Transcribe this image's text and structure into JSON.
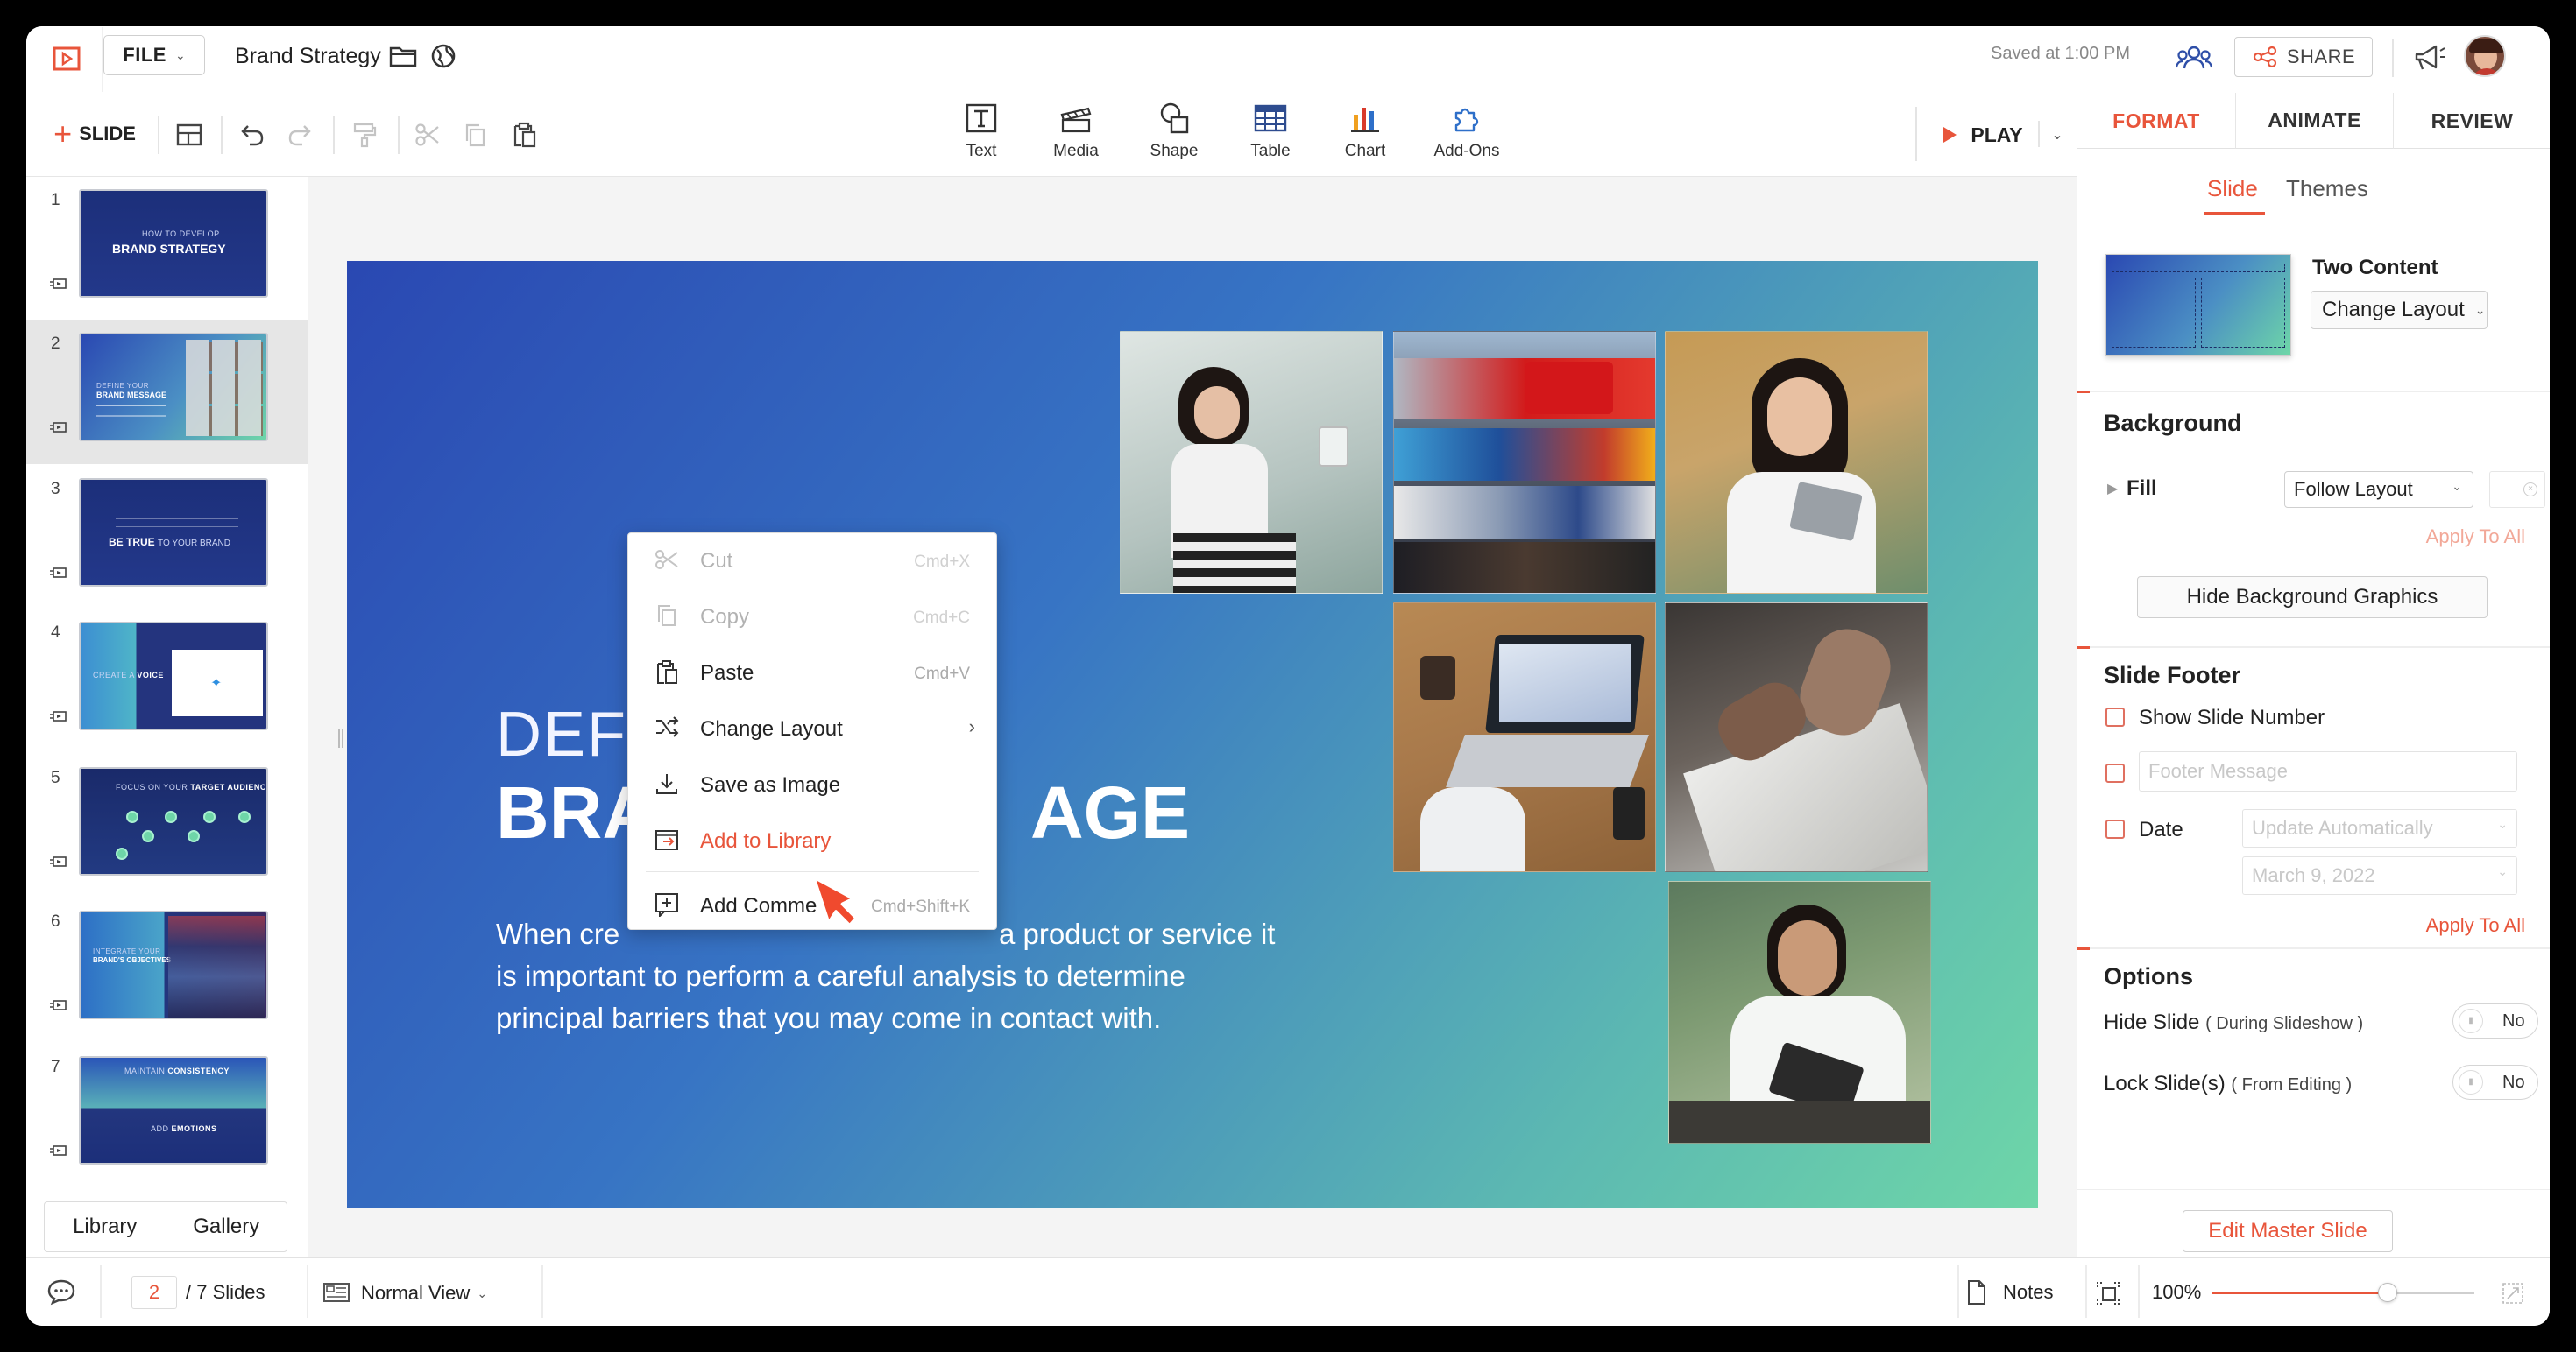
{
  "app": {
    "file_menu": "FILE",
    "doc_title": "Brand Strategy",
    "saved_status": "Saved at 1:00 PM",
    "share": "SHARE",
    "colors": {
      "accent": "#e8553b",
      "slide_from": "#2a48b2",
      "slide_to": "#6ed6a8"
    }
  },
  "toolbar": {
    "new_slide": "SLIDE",
    "insert": [
      {
        "label": "Text",
        "icon": "text-icon"
      },
      {
        "label": "Media",
        "icon": "media-icon"
      },
      {
        "label": "Shape",
        "icon": "shape-icon"
      },
      {
        "label": "Table",
        "icon": "table-icon"
      },
      {
        "label": "Chart",
        "icon": "chart-icon"
      },
      {
        "label": "Add-Ons",
        "icon": "add-ons-icon"
      }
    ],
    "play": "PLAY"
  },
  "right_tabs": [
    "FORMAT",
    "ANIMATE",
    "REVIEW"
  ],
  "format": {
    "subtabs": [
      "Slide",
      "Themes"
    ],
    "layout_name": "Two Content",
    "change_layout": "Change Layout",
    "background": {
      "title": "Background",
      "fill_label": "Fill",
      "fill_value": "Follow Layout",
      "apply_all": "Apply To All",
      "hide_bg": "Hide Background Graphics"
    },
    "footer": {
      "title": "Slide Footer",
      "show_number": "Show Slide Number",
      "footer_placeholder": "Footer Message",
      "date_label": "Date",
      "date_mode": "Update Automatically",
      "date_value": "March 9, 2022",
      "apply_all": "Apply To All"
    },
    "options": {
      "title": "Options",
      "hide_slide": "Hide Slide",
      "hide_slide_note": "( During Slideshow )",
      "hide_slide_value": "No",
      "lock_slide": "Lock Slide(s)",
      "lock_slide_note": "( From Editing )",
      "lock_slide_value": "No"
    },
    "edit_master": "Edit Master Slide"
  },
  "slides": [
    {
      "num": "1",
      "sub": "HOW TO DEVELOP",
      "main": "BRAND STRATEGY"
    },
    {
      "num": "2",
      "sub": "DEFINE YOUR",
      "main": "BRAND MESSAGE"
    },
    {
      "num": "3",
      "sub": "",
      "main": "BE TRUE",
      "main_rest": "TO YOUR BRAND"
    },
    {
      "num": "4",
      "sub": "CREATE A",
      "main": "VOICE"
    },
    {
      "num": "5",
      "sub": "FOCUS ON YOUR",
      "main": "TARGET AUDIENCE"
    },
    {
      "num": "6",
      "sub": "INTEGRATE YOUR",
      "main": "BRAND'S OBJECTIVES"
    },
    {
      "num": "7",
      "sub": "MAINTAIN",
      "main": "CONSISTENCY",
      "main2_sub": "ADD",
      "main2": "EMOTIONS"
    }
  ],
  "left_tabs": [
    "Library",
    "Gallery"
  ],
  "slide": {
    "title_line1": "DEFI",
    "title_line2_a": "BRA",
    "title_line2_b": "AGE",
    "body_a": "When cre",
    "body_b": "a product or service it",
    "body_line2": "is important to perform a careful analysis to determine",
    "body_line3": "principal barriers that you may come in contact with."
  },
  "context_menu": [
    {
      "label": "Cut",
      "shortcut": "Cmd+X",
      "icon": "scissors-icon",
      "disabled": true
    },
    {
      "label": "Copy",
      "shortcut": "Cmd+C",
      "icon": "copy-icon",
      "disabled": true
    },
    {
      "label": "Paste",
      "shortcut": "Cmd+V",
      "icon": "paste-icon"
    },
    {
      "label": "Change Layout",
      "shortcut": "",
      "icon": "shuffle-icon",
      "submenu": true
    },
    {
      "label": "Save as Image",
      "shortcut": "",
      "icon": "download-icon"
    },
    {
      "label": "Add to Library",
      "shortcut": "",
      "icon": "library-icon",
      "highlight": true
    },
    {
      "label": "Add Comme",
      "shortcut": "Cmd+Shift+K",
      "icon": "comment-plus-icon"
    }
  ],
  "status": {
    "current_slide": "2",
    "total": "/ 7 Slides",
    "view": "Normal View",
    "notes": "Notes",
    "zoom": "100%",
    "zoom_fraction": 0.67
  }
}
